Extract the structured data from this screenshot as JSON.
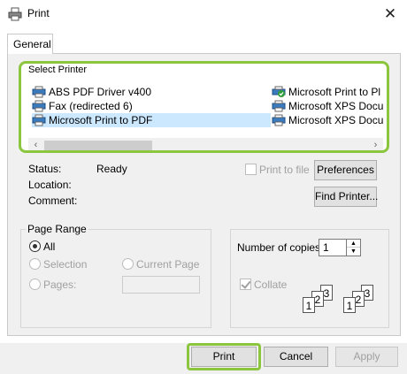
{
  "window": {
    "title": "Print",
    "close_glyph": "✕"
  },
  "tabs": [
    {
      "label": "General"
    }
  ],
  "select_printer": {
    "label": "Select Printer",
    "printers": [
      {
        "name": "ABS PDF Driver v400",
        "selected": false,
        "default": false
      },
      {
        "name": "Fax (redirected 6)",
        "selected": false,
        "default": false
      },
      {
        "name": "Microsoft Print to PDF",
        "selected": true,
        "default": false
      },
      {
        "name": "Microsoft Print to Pl",
        "selected": false,
        "default": true
      },
      {
        "name": "Microsoft XPS Docu",
        "selected": false,
        "default": false
      },
      {
        "name": "Microsoft XPS Docu",
        "selected": false,
        "default": false
      }
    ],
    "scroll_left": "‹",
    "scroll_right": "›"
  },
  "status": {
    "status_label": "Status:",
    "status_value": "Ready",
    "location_label": "Location:",
    "location_value": "",
    "comment_label": "Comment:",
    "comment_value": "",
    "print_to_file_label": "Print to file",
    "print_to_file_checked": false,
    "preferences_label": "Preferences",
    "find_printer_label": "Find Printer..."
  },
  "page_range": {
    "label": "Page Range",
    "all_label": "All",
    "selection_label": "Selection",
    "current_page_label": "Current Page",
    "pages_label": "Pages:",
    "pages_value": "",
    "selected_option": "All"
  },
  "copies": {
    "label": "Number of copies:",
    "value": "1",
    "collate_label": "Collate",
    "collate_checked": true
  },
  "collate_sheets": [
    "1",
    "2",
    "3"
  ],
  "buttons": {
    "print": "Print",
    "cancel": "Cancel",
    "apply": "Apply"
  },
  "colors": {
    "accent": "#8cc63f",
    "selection": "#cce8ff",
    "panel": "#f0f0f0"
  }
}
